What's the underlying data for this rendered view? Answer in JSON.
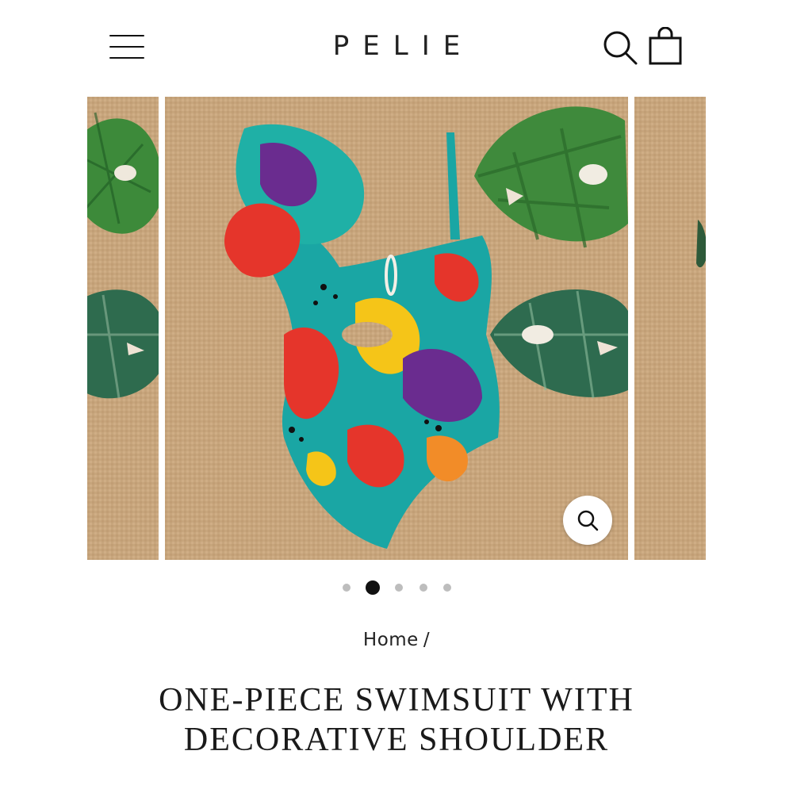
{
  "header": {
    "logo": "PELIE",
    "icons": {
      "menu": "hamburger-menu-icon",
      "search": "search-icon",
      "cart": "shopping-bag-icon"
    }
  },
  "gallery": {
    "image_alt": "ONE-PIECE SWIMSUIT WITH DECORATIVE SHOULDER",
    "image_count": 5,
    "active_index": 1,
    "zoom_icon": "zoom-magnifier-icon",
    "colors": {
      "burlap": "#c9a87e",
      "leaf": "#3a7a3a",
      "teal": "#1aa6a4",
      "red": "#e5352b",
      "yellow": "#f5c518",
      "purple": "#6a2c8f"
    }
  },
  "breadcrumb": {
    "home": "Home",
    "separator": "/"
  },
  "product": {
    "title_line1": "ONE-PIECE SWIMSUIT WITH",
    "title_line2": "DECORATIVE SHOULDER"
  }
}
